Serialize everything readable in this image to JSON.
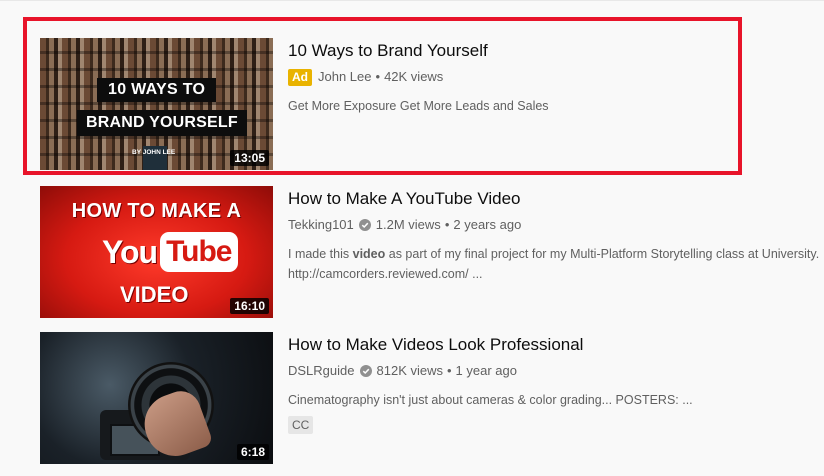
{
  "results": [
    {
      "title": "10 Ways to Brand Yourself",
      "ad_label": "Ad",
      "channel": "John Lee",
      "separator": "•",
      "views": "42K views",
      "description": "Get More Exposure Get More Leads and Sales",
      "duration": "13:05",
      "thumb_text": {
        "line1": "10 WAYS TO",
        "line2": "BRAND YOURSELF",
        "byline": "BY JOHN LEE"
      },
      "highlighted": true
    },
    {
      "title": "How to Make A YouTube Video",
      "channel": "Tekking101",
      "verified": true,
      "views": "1.2M views",
      "separator": "•",
      "age": "2 years ago",
      "description_parts": {
        "before": "I made this ",
        "bold": "video",
        "after": " as part of my final project for my Multi-Platform Storytelling class at University.",
        "line2": "http://camcorders.reviewed.com/ ..."
      },
      "duration": "16:10",
      "thumb_text": {
        "line1": "HOW TO MAKE A",
        "you": "You",
        "tube": "Tube",
        "line3": "VIDEO"
      }
    },
    {
      "title": "How to Make Videos Look Professional",
      "channel": "DSLRguide",
      "verified": true,
      "views": "812K views",
      "separator": "•",
      "age": "1 year ago",
      "description": "Cinematography isn't just about cameras & color grading... POSTERS: ...",
      "badge": "CC",
      "duration": "6:18"
    }
  ],
  "colors": {
    "highlight_border": "#e8142a",
    "ad_badge": "#e9b300",
    "title_text": "#0d0d0d",
    "meta_text": "#606060",
    "background": "#f9f9f9"
  }
}
